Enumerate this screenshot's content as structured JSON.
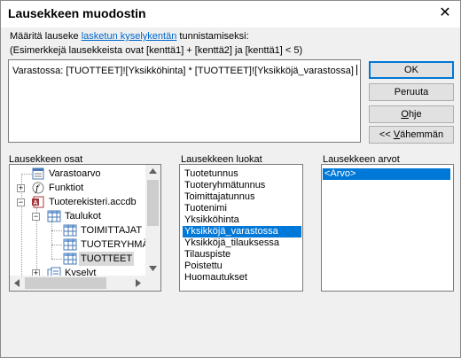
{
  "dialog": {
    "title": "Lausekkeen muodostin"
  },
  "prompt": {
    "line1_before": "Määritä lauseke ",
    "line1_link": "lasketun kyselykentän",
    "line1_after": " tunnistamiseksi:",
    "line2": "(Esimerkkejä lausekkeista ovat [kenttä1] + [kenttä2] ja [kenttä1] < 5)"
  },
  "expression": {
    "value": "Varastossa:  [TUOTTEET]![Yksikköhinta] * [TUOTTEET]![Yksikköjä_varastossa]"
  },
  "buttons": {
    "ok": "OK",
    "cancel": "Peruuta",
    "help_underlined": "O",
    "help_rest": "hje",
    "less_prefix": "<< ",
    "less_underlined": "V",
    "less_rest": "ähemmän"
  },
  "elements_panel": {
    "label": "Lausekkeen osat",
    "items": [
      {
        "label": "Varastoarvo",
        "icon": "form-icon"
      },
      {
        "label": "Funktiot",
        "icon": "function-icon"
      },
      {
        "label": "Tuoterekisteri.accdb",
        "icon": "access-database-icon"
      },
      {
        "label": "Taulukot",
        "icon": "tables-icon"
      },
      {
        "label": "TOIMITTAJAT",
        "icon": "table-icon"
      },
      {
        "label": "TUOTERYHMÄT",
        "icon": "table-icon"
      },
      {
        "label": "TUOTTEET",
        "icon": "table-icon"
      },
      {
        "label": "Kyselyt",
        "icon": "queries-icon"
      }
    ]
  },
  "categories_panel": {
    "label": "Lausekkeen luokat",
    "items": [
      "Tuotetunnus",
      "Tuoteryhmätunnus",
      "Toimittajatunnus",
      "Tuotenimi",
      "Yksikköhinta",
      "Yksikköjä_varastossa",
      "Yksikköjä_tilauksessa",
      "Tilauspiste",
      "Poistettu",
      "Huomautukset"
    ],
    "selected": "Yksikköjä_varastossa"
  },
  "values_panel": {
    "label": "Lausekkeen arvot",
    "items": [
      "<Arvo>"
    ],
    "selected": "<Arvo>"
  },
  "colors": {
    "selection": "#0078d7",
    "link": "#0066cc"
  }
}
